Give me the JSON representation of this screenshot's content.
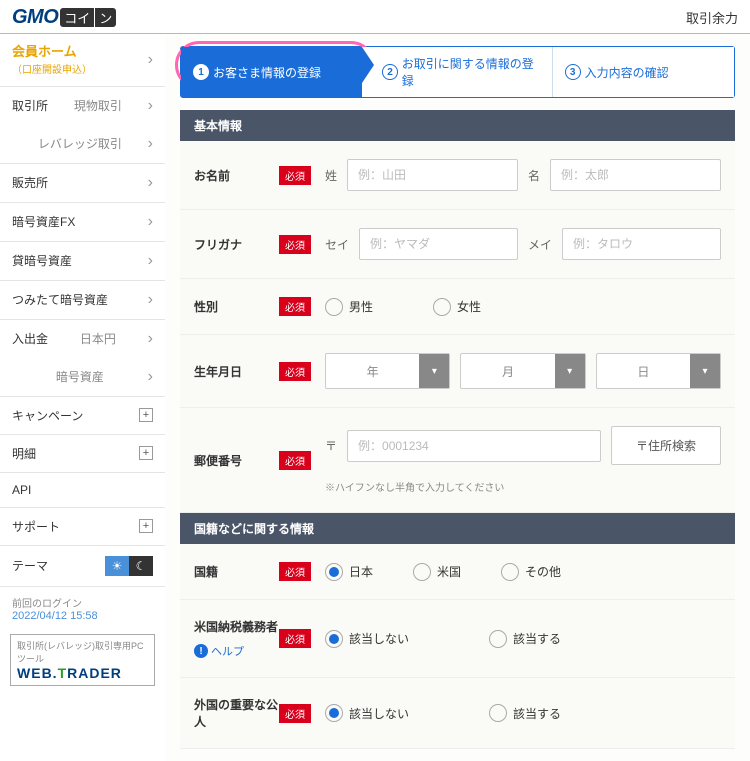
{
  "header": {
    "logo_gmo": "GMO",
    "logo_coin1": "コイ",
    "logo_coin2": "ン",
    "right_label": "取引余力"
  },
  "sidebar": {
    "home_title": "会員ホーム",
    "home_sub": "（口座開設申込）",
    "exchange_label": "取引所",
    "exchange_spot": "現物取引",
    "exchange_leverage": "レバレッジ取引",
    "sales_label": "販売所",
    "fx_label": "暗号資産FX",
    "lending_label": "貸暗号資産",
    "savings_label": "つみたて暗号資産",
    "deposit_label": "入出金",
    "deposit_jpy": "日本円",
    "deposit_crypto": "暗号資産",
    "campaign_label": "キャンペーン",
    "statement_label": "明細",
    "api_label": "API",
    "support_label": "サポート",
    "theme_label": "テーマ",
    "last_login_label": "前回のログイン",
    "last_login_time": "2022/04/12 15:58",
    "webtrader_caption": "取引所(レバレッジ)取引専用PCツール"
  },
  "steps": {
    "s1": "お客さま情報の登録",
    "s2": "お取引に関する情報の登録",
    "s3": "入力内容の確認"
  },
  "sections": {
    "basic": "基本情報",
    "nationality": "国籍などに関する情報"
  },
  "labels": {
    "required": "必須",
    "name": "お名前",
    "furigana": "フリガナ",
    "gender": "性別",
    "birthdate": "生年月日",
    "postal": "郵便番号",
    "nationality": "国籍",
    "us_tax": "米国納税義務者",
    "foreign_pep": "外国の重要な公人",
    "sei_kanji": "姓",
    "mei_kanji": "名",
    "sei_kana": "セイ",
    "mei_kana": "メイ",
    "postal_mark": "〒",
    "help": "ヘルプ"
  },
  "placeholders": {
    "sei_kanji": "例：山田",
    "mei_kanji": "例：太郎",
    "sei_kana": "例：ヤマダ",
    "mei_kana": "例：タロウ",
    "postal": "例：0001234"
  },
  "options": {
    "gender_male": "男性",
    "gender_female": "女性",
    "year": "年",
    "month": "月",
    "day": "日",
    "postal_search": "〒住所検索",
    "postal_hint": "※ハイフンなし半角で入力してください",
    "nat_japan": "日本",
    "nat_us": "米国",
    "nat_other": "その他",
    "not_applicable": "該当しない",
    "applicable": "該当する"
  }
}
